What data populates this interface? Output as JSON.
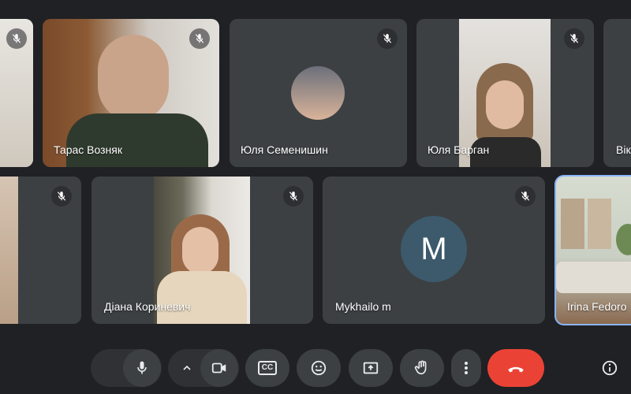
{
  "participants": [
    {
      "name": "",
      "muted": true
    },
    {
      "name": "Тарас Возняк",
      "muted": true
    },
    {
      "name": "Юля Семенишин",
      "muted": true
    },
    {
      "name": "Юля Барган",
      "muted": true
    },
    {
      "name": "Вік",
      "muted": false
    },
    {
      "name": "",
      "muted": true
    },
    {
      "name": "Діана Кориневич",
      "muted": true
    },
    {
      "name": "Mykhailo m",
      "muted": true,
      "initial": "M"
    },
    {
      "name": "Irina Fedoro",
      "muted": false
    }
  ],
  "toolbar": {
    "mic_options_icon": "chevron-up-icon",
    "mic_icon": "microphone-icon",
    "camera_options_icon": "chevron-up-icon",
    "camera_icon": "camera-icon",
    "captions_label": "CC",
    "emoji_icon": "smiley-icon",
    "present_icon": "present-screen-icon",
    "hand_icon": "raise-hand-icon",
    "more_icon": "more-vert-icon",
    "end_call_icon": "end-call-icon",
    "info_icon": "info-icon"
  },
  "colors": {
    "background": "#202124",
    "tile": "#3c4043",
    "end_call": "#ea4335",
    "active_border": "#8ab4f8",
    "avatar_m": "#3c5a6b"
  }
}
